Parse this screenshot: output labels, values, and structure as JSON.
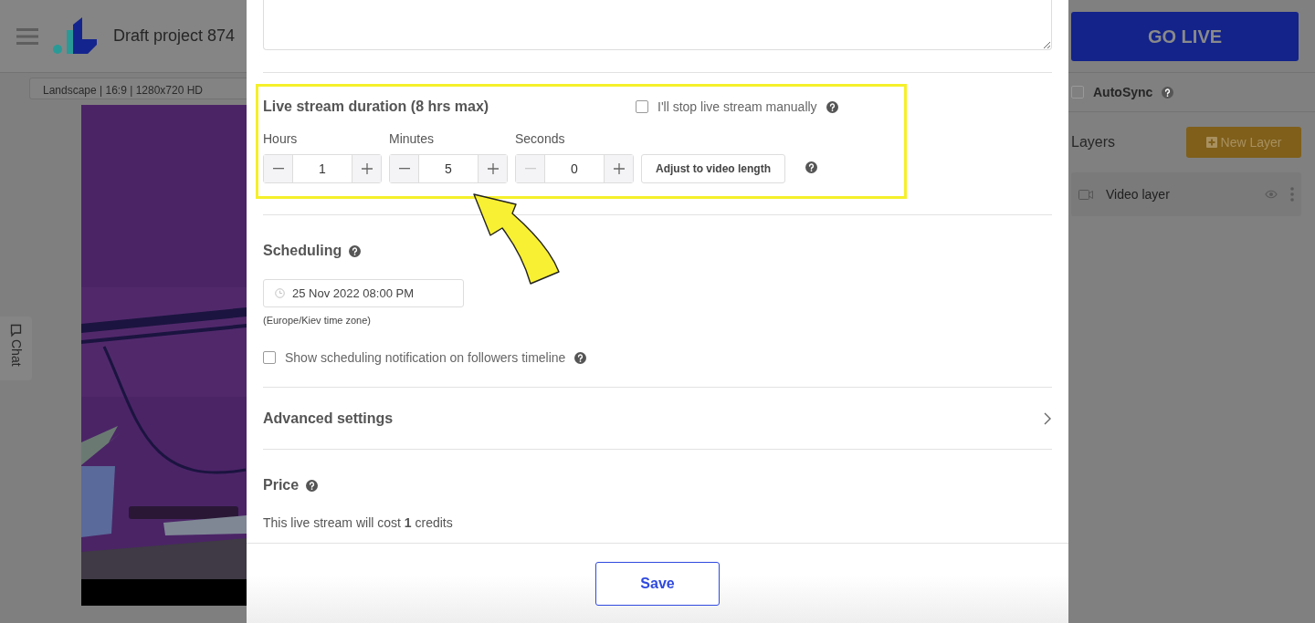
{
  "header": {
    "title": "Draft project 874"
  },
  "format_select": {
    "value": "Landscape | 16:9 | 1280x720 HD"
  },
  "chat_tab": {
    "label": "Chat"
  },
  "go_live": {
    "label": "GO LIVE"
  },
  "autosync": {
    "label": "AutoSync",
    "checked": false
  },
  "layers": {
    "title": "Layers",
    "new_button": "New Layer",
    "items": [
      {
        "name": "Video layer"
      }
    ]
  },
  "modal": {
    "duration": {
      "title": "Live stream duration (8 hrs max)",
      "manual_stop": {
        "label": "I'll stop live stream manually",
        "checked": false
      },
      "fields": [
        {
          "label": "Hours",
          "value": "1",
          "minus_disabled": false
        },
        {
          "label": "Minutes",
          "value": "5",
          "minus_disabled": false
        },
        {
          "label": "Seconds",
          "value": "0",
          "minus_disabled": true
        }
      ],
      "adjust_button": "Adjust to video length"
    },
    "scheduling": {
      "title": "Scheduling",
      "datetime": "25 Nov 2022 08:00 PM",
      "timezone": "(Europe/Kiev time zone)",
      "notify": {
        "label": "Show scheduling notification on followers timeline",
        "checked": false
      }
    },
    "advanced": {
      "title": "Advanced settings",
      "expanded": false
    },
    "price": {
      "title": "Price",
      "text": "This live stream will cost **1** credits"
    },
    "save": "Save"
  }
}
